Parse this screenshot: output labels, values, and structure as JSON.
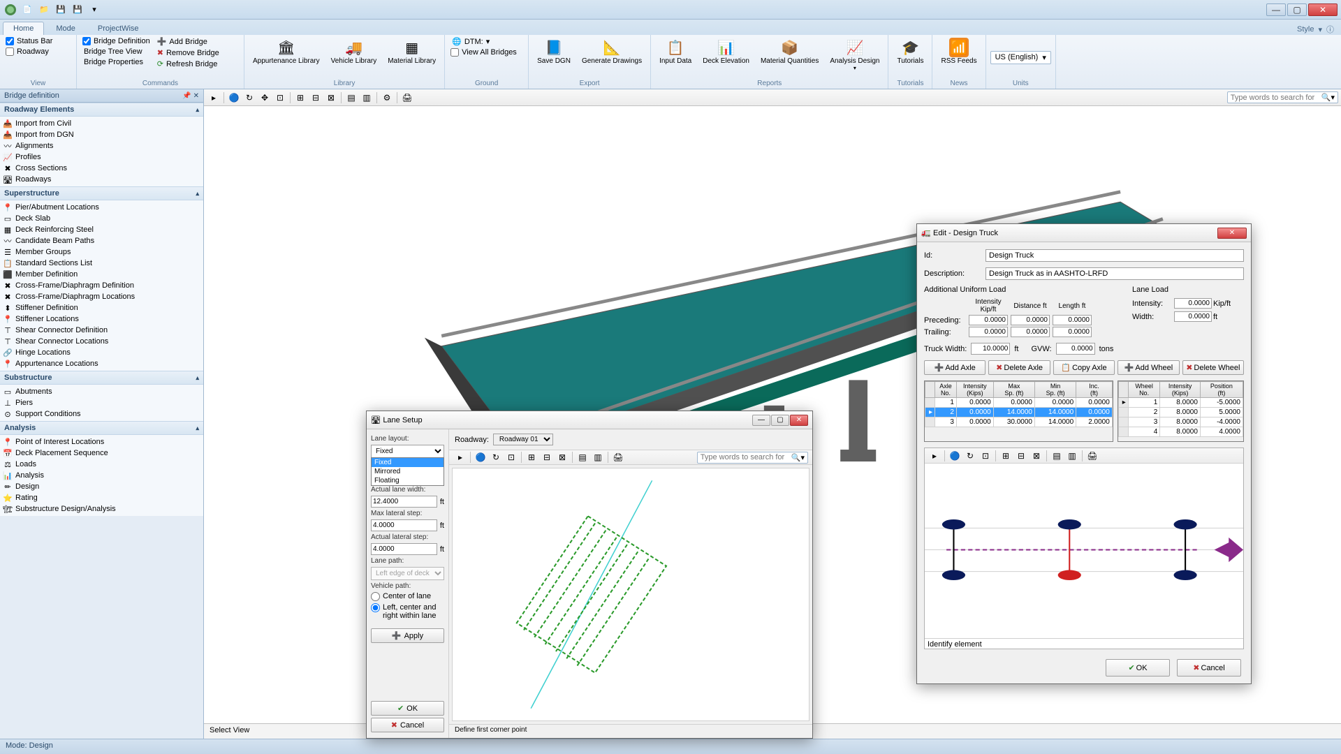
{
  "titlebar": {
    "min": "—",
    "max": "▢",
    "close": "✕"
  },
  "tabs": {
    "home": "Home",
    "mode": "Mode",
    "projectwise": "ProjectWise",
    "style": "Style"
  },
  "ribbon": {
    "view": {
      "status_bar": "Status Bar",
      "roadway": "Roadway",
      "bridge_def": "Bridge Definition",
      "tree": "Bridge Tree View",
      "props": "Bridge Properties",
      "label": "View"
    },
    "commands": {
      "add": "Add Bridge",
      "remove": "Remove Bridge",
      "refresh": "Refresh Bridge",
      "label": "Commands"
    },
    "library": {
      "appurt": "Appurtenance Library",
      "vehicle": "Vehicle Library",
      "material": "Material Library",
      "label": "Library"
    },
    "ground": {
      "dtm": "DTM:",
      "view_all": "View All Bridges",
      "label": "Ground"
    },
    "export": {
      "save": "Save DGN",
      "gen": "Generate Drawings",
      "label": "Export"
    },
    "reports": {
      "input": "Input Data",
      "deck": "Deck Elevation",
      "matq": "Material Quantities",
      "analysis": "Analysis Design",
      "label": "Reports"
    },
    "tutorials": {
      "tut": "Tutorials",
      "label": "Tutorials"
    },
    "news": {
      "rss": "RSS Feeds",
      "label": "News"
    },
    "units": {
      "lang": "US (English)",
      "label": "Units"
    }
  },
  "leftpanel": {
    "title": "Bridge definition",
    "roadway": {
      "head": "Roadway Elements",
      "items": [
        "Import from Civil",
        "Import from DGN",
        "Alignments",
        "Profiles",
        "Cross Sections",
        "Roadways"
      ]
    },
    "super": {
      "head": "Superstructure",
      "items": [
        "Pier/Abutment Locations",
        "Deck Slab",
        "Deck Reinforcing Steel",
        "Candidate Beam Paths",
        "Member Groups",
        "Standard Sections List",
        "Member Definition",
        "Cross-Frame/Diaphragm Definition",
        "Cross-Frame/Diaphragm Locations",
        "Stiffener Definition",
        "Stiffener Locations",
        "Shear Connector Definition",
        "Shear Connector Locations",
        "Hinge Locations",
        "Appurtenance Locations"
      ]
    },
    "sub": {
      "head": "Substructure",
      "items": [
        "Abutments",
        "Piers",
        "Support Conditions"
      ]
    },
    "analysis": {
      "head": "Analysis",
      "items": [
        "Point of Interest Locations",
        "Deck Placement Sequence",
        "Loads",
        "Analysis",
        "Design",
        "Rating",
        "Substructure Design/Analysis"
      ]
    }
  },
  "viewport": {
    "search_ph": "Type words to search for",
    "select_view": "Select View"
  },
  "statusbar": {
    "mode": "Mode: Design"
  },
  "lane": {
    "title": "Lane Setup",
    "layout_label": "Lane layout:",
    "layout_value": "Fixed",
    "layout_options": [
      "Fixed",
      "Mirrored",
      "Floating"
    ],
    "roadway_label": "Roadway:",
    "roadway_value": "Roadway 01",
    "actual_width_label": "Actual lane width:",
    "actual_width": "12.4000",
    "ft": "ft",
    "max_step_label": "Max lateral step:",
    "max_step": "4.0000",
    "actual_step_label": "Actual lateral step:",
    "actual_step": "4.0000",
    "lane_path_label": "Lane path:",
    "lane_path": "Left edge of deck",
    "vehicle_path_label": "Vehicle path:",
    "vp_center": "Center of lane",
    "vp_left": "Left, center and right within lane",
    "apply": "Apply",
    "ok": "OK",
    "cancel": "Cancel",
    "search_ph": "Type words to search for",
    "status": "Define first corner point"
  },
  "truck": {
    "title": "Edit - Design Truck",
    "id_label": "Id:",
    "id": "Design Truck",
    "desc_label": "Description:",
    "desc": "Design Truck as in AASHTO-LRFD",
    "aul": "Additional Uniform Load",
    "lane_load": "Lane Load",
    "intensity_hd": "Intensity Kip/ft",
    "distance_hd": "Distance ft",
    "length_hd": "Length ft",
    "preceding": "Preceding:",
    "trailing": "Trailing:",
    "intensity": "Intensity:",
    "width": "Width:",
    "kipft": "Kip/ft",
    "ft": "ft",
    "truck_width_label": "Truck Width:",
    "truck_width": "10.0000",
    "gvw_label": "GVW:",
    "gvw": "0.0000",
    "tons": "tons",
    "zero": "0.0000",
    "int_val": "0.0000",
    "width_val": "0.0000",
    "add_axle": "Add Axle",
    "del_axle": "Delete Axle",
    "copy_axle": "Copy Axle",
    "add_wheel": "Add Wheel",
    "del_wheel": "Delete Wheel",
    "axle_cols": [
      "Axle No.",
      "Intensity (Kips)",
      "Max Sp. (ft)",
      "Min Sp. (ft)",
      "Inc. (ft)"
    ],
    "axle_rows": [
      [
        "1",
        "0.0000",
        "0.0000",
        "0.0000",
        "0.0000"
      ],
      [
        "2",
        "0.0000",
        "14.0000",
        "14.0000",
        "0.0000"
      ],
      [
        "3",
        "0.0000",
        "30.0000",
        "14.0000",
        "2.0000"
      ]
    ],
    "wheel_cols": [
      "Wheel No.",
      "Intensity (Kips)",
      "Position (ft)"
    ],
    "wheel_rows": [
      [
        "1",
        "8.0000",
        "-5.0000"
      ],
      [
        "2",
        "8.0000",
        "5.0000"
      ],
      [
        "3",
        "8.0000",
        "-4.0000"
      ],
      [
        "4",
        "8.0000",
        "4.0000"
      ]
    ],
    "identify": "Identify element",
    "ok": "OK",
    "cancel": "Cancel"
  }
}
